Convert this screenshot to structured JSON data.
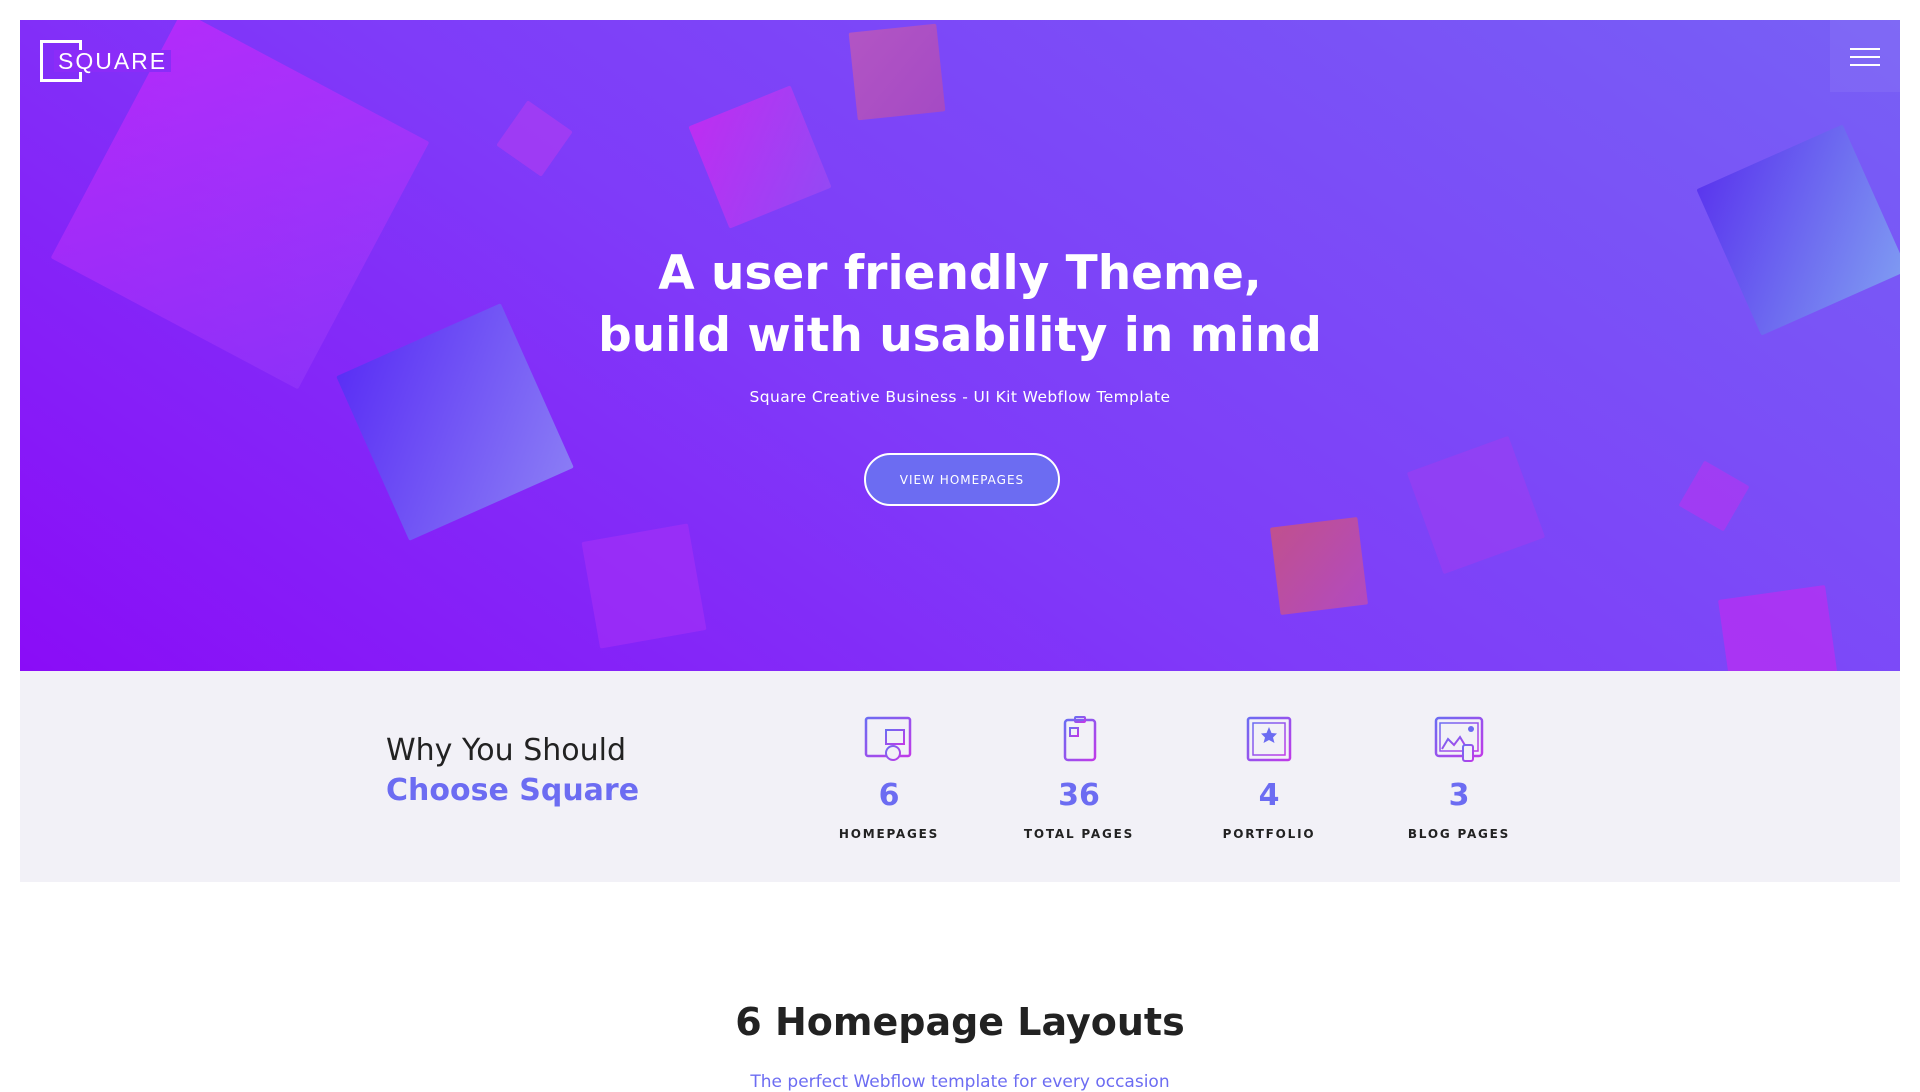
{
  "brand": {
    "logo_text": "SQUARE"
  },
  "hero": {
    "title_line1": "A user friendly Theme,",
    "title_line2": "build with usability in mind",
    "subtitle": "Square Creative Business - UI Kit Webflow Template",
    "button_label": "VIEW HOMEPAGES"
  },
  "why": {
    "line1": "Why You Should",
    "line2": "Choose Square"
  },
  "stats": [
    {
      "number": "6",
      "label": "HOMEPAGES",
      "icon": "browser-layout-icon"
    },
    {
      "number": "36",
      "label": "TOTAL PAGES",
      "icon": "document-page-icon"
    },
    {
      "number": "4",
      "label": "PORTFOLIO",
      "icon": "star-frame-icon"
    },
    {
      "number": "3",
      "label": "BLOG PAGES",
      "icon": "image-gallery-icon"
    }
  ],
  "layouts": {
    "title": "6 Homepage Layouts",
    "subtitle": "The perfect Webflow template for every occasion"
  },
  "colors": {
    "accent": "#6c6cf2",
    "hero_start": "#8a0cf7",
    "hero_end": "#7760f5",
    "stats_bg": "#f2f1f7"
  }
}
